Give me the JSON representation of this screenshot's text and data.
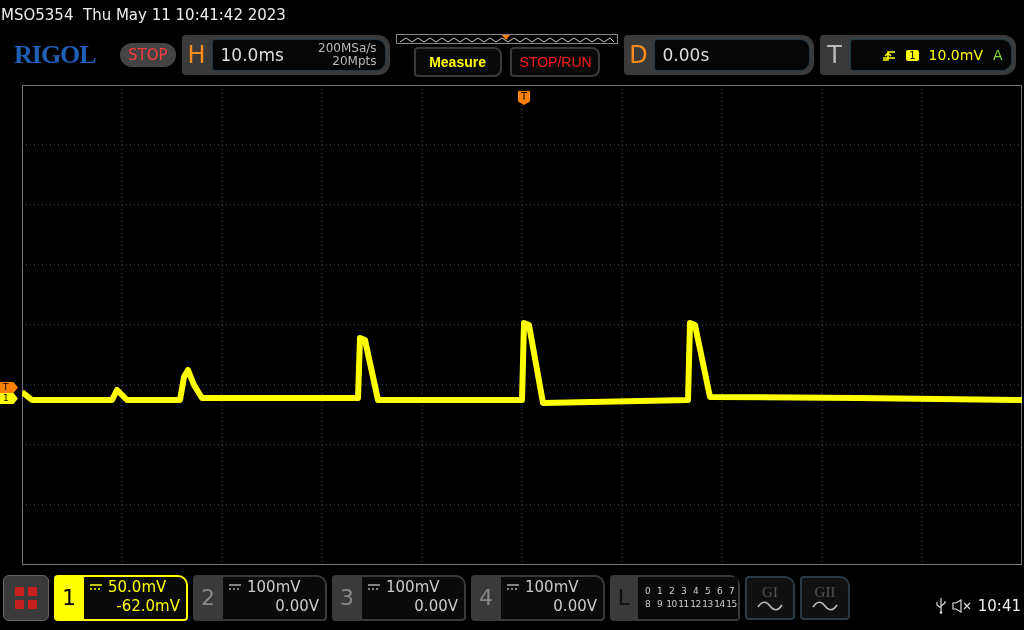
{
  "status_line": "MSO5354  Thu May 11 10:41:42 2023",
  "logo": "RIGOL",
  "run_state": "STOP",
  "horizontal": {
    "label": "H",
    "timebase": "10.0ms",
    "sample_rate": "200MSa/s",
    "memory_depth": "20Mpts"
  },
  "buttons": [
    {
      "label": "Measure",
      "kind": "measure"
    },
    {
      "label": "STOP/RUN",
      "kind": "stoprun"
    }
  ],
  "delay": {
    "label": "D",
    "value": "0.00s"
  },
  "trigger": {
    "label": "T",
    "source": "1",
    "level": "10.0mV",
    "mode": "A"
  },
  "trigger_marker": "T",
  "left_markers": [
    {
      "label": "T",
      "color": "#ff8000"
    },
    {
      "label": "1",
      "color": "#ffff00"
    }
  ],
  "channels": [
    {
      "number": "1",
      "scale": "50.0mV",
      "offset": "-62.0mV",
      "selected": true
    },
    {
      "number": "2",
      "scale": "100mV",
      "offset": "0.00V",
      "selected": false
    },
    {
      "number": "3",
      "scale": "100mV",
      "offset": "0.00V",
      "selected": false
    },
    {
      "number": "4",
      "scale": "100mV",
      "offset": "0.00V",
      "selected": false
    }
  ],
  "logic": {
    "label": "L",
    "rows": [
      [
        "0",
        "1",
        "2",
        "3",
        "4",
        "5",
        "6",
        "7"
      ],
      [
        "8",
        "9",
        "10",
        "11",
        "12",
        "13",
        "14",
        "15"
      ]
    ]
  },
  "generators": [
    {
      "label": "GI"
    },
    {
      "label": "GII"
    }
  ],
  "clock": "10:41"
}
